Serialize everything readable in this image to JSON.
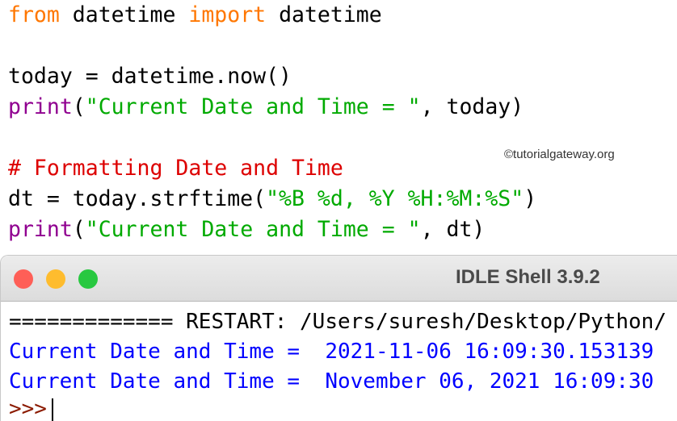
{
  "editor": {
    "l1": {
      "k1": "from",
      "t1": " datetime ",
      "k2": "import",
      "t2": " datetime"
    },
    "l3": "today = datetime.now()",
    "l4": {
      "f": "print",
      "a": "(",
      "s": "\"Current Date and Time = \"",
      "b": ", today)"
    },
    "l6": "# Formatting Date and Time",
    "l7": {
      "a": "dt = today.strftime(",
      "s": "\"%B %d, %Y %H:%M:%S\"",
      "b": ")"
    },
    "l8": {
      "f": "print",
      "a": "(",
      "s": "\"Current Date and Time = \"",
      "b": ", dt)"
    }
  },
  "watermark": "©tutorialgateway.org",
  "shell": {
    "title": "IDLE Shell 3.9.2",
    "restart": "============= RESTART: /Users/suresh/Desktop/Python/",
    "out1": "Current Date and Time =  2021-11-06 16:09:30.153139",
    "out2": "Current Date and Time =  November 06, 2021 16:09:30",
    "prompt": ">>>"
  },
  "colors": {
    "close": "#fe5f57",
    "minimize": "#febc2e",
    "zoom": "#28c840"
  }
}
